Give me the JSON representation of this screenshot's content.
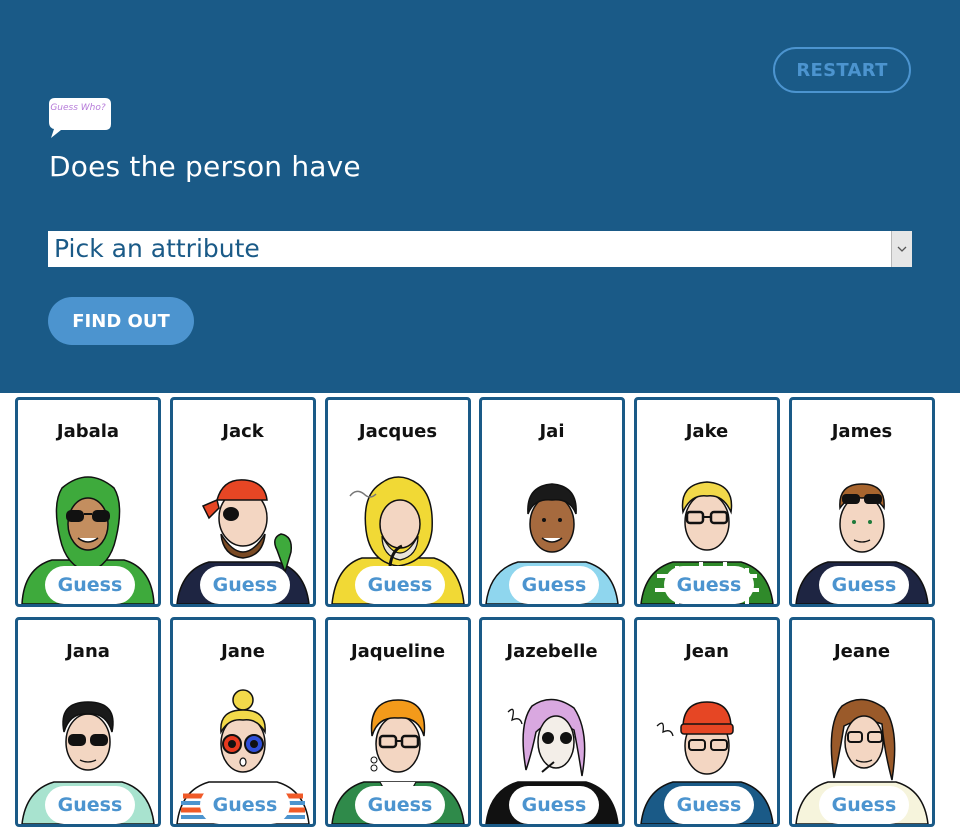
{
  "header": {
    "restart_label": "RESTART",
    "logo_text": "Guess Who?",
    "question": "Does the person have",
    "select_value": "Pick an attribute",
    "find_out_label": "FIND OUT"
  },
  "guess_label": "Guess",
  "characters": [
    {
      "name": "Jabala"
    },
    {
      "name": "Jack"
    },
    {
      "name": "Jacques"
    },
    {
      "name": "Jai"
    },
    {
      "name": "Jake"
    },
    {
      "name": "James"
    },
    {
      "name": "Jana"
    },
    {
      "name": "Jane"
    },
    {
      "name": "Jaqueline"
    },
    {
      "name": "Jazebelle"
    },
    {
      "name": "Jean"
    },
    {
      "name": "Jeane"
    }
  ],
  "colors": {
    "header_bg": "#1a5a87",
    "accent": "#4c94cf",
    "card_border": "#1a5a87",
    "logo_text": "#b67bd9"
  }
}
